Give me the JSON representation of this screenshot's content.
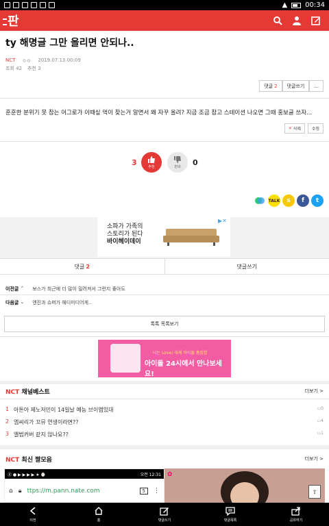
{
  "status": {
    "time": "00:34"
  },
  "appbar": {
    "logo": "판"
  },
  "post": {
    "title": "ty 해명글 그만 올리면 안되나..",
    "category": "NCT",
    "author": "ㅇㅇ",
    "date": "2019.07.13 00:09",
    "views": "조회 42",
    "recommends": "추천 3",
    "body": "훈훈한 분위기 못 참는 어그로가 이때싶 먹이 찾는거 알면서 왜 자꾸 올려? 지금 조금 참고 스테이션 나오면 그때 홍보글 쓰자..."
  },
  "actions": {
    "comment_label": "댓글",
    "comment_count": "2",
    "write_comment": "댓글쓰기",
    "more": "...",
    "delete": "삭제",
    "edit": "수정"
  },
  "vote": {
    "up_count": "3",
    "up_label": "추천",
    "down_label": "반대",
    "down_count": "0"
  },
  "ad": {
    "line1": "소파가 가족의",
    "line2": "스토리가 된다",
    "line3": "바이헤이데이"
  },
  "tabs": {
    "comment_label": "댓글",
    "comment_count": "2",
    "write": "댓글쓰기"
  },
  "nav": {
    "prev_label": "이전글",
    "prev_text": "보스가 최근에 더 많이 밀려져서 그런지 좋아도",
    "next_label": "다음글",
    "next_text": "엔진과 슈퍼가 헤디미디어게.."
  },
  "list_button": "톡톡 목록보기",
  "banner": {
    "line1": "너는 Love! 대세 아이돌 총집합",
    "line2": "아이돌 24시에서 만나보세요!"
  },
  "best": {
    "prefix": "NCT",
    "title": "채널베스트",
    "more": "더보기 >",
    "items": [
      {
        "num": "1",
        "text": "아튼아 제노저민이 14일날 예능 브이앱있대",
        "comments": "0"
      },
      {
        "num": "2",
        "text": "엠씨리가 꼬뮤 연생이라면??",
        "comments": "4"
      },
      {
        "num": "3",
        "text": "앨범커버 같지 않나요??",
        "comments": "1"
      }
    ]
  },
  "latest": {
    "prefix": "NCT",
    "title": "최신 짤모음",
    "more": "더보기 >"
  },
  "thumb": {
    "time": "오전 12:31",
    "url": "ttps://m.pann.nate.com",
    "tabs": "5"
  },
  "bottombar": [
    "이전",
    "홈",
    "댓글쓰기",
    "댓글목록",
    "공유하기"
  ]
}
